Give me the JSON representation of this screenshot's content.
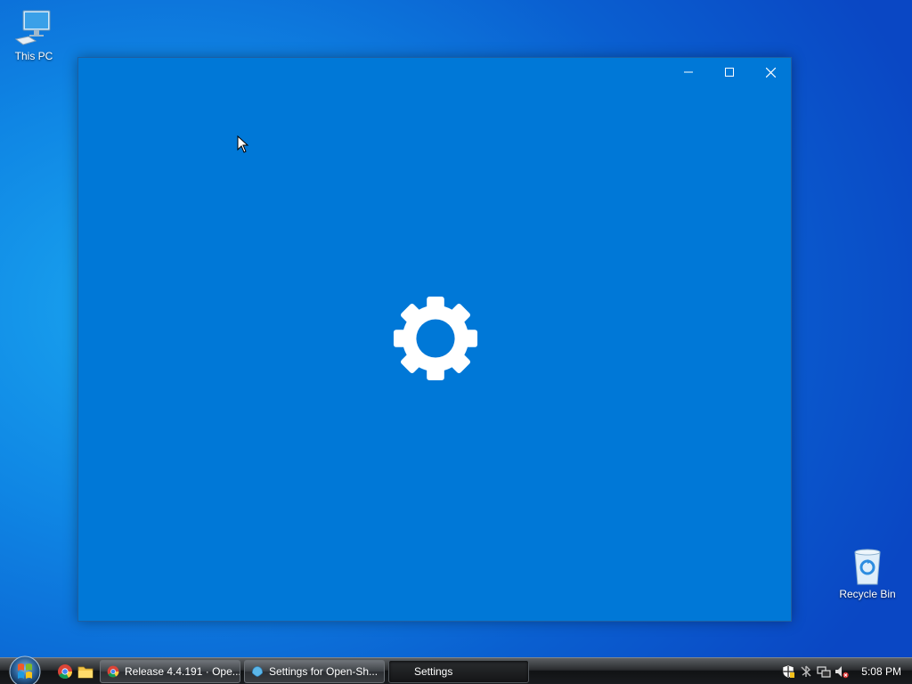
{
  "desktop": {
    "icons": [
      {
        "label": "This PC"
      },
      {
        "label": "Recycle Bin"
      }
    ]
  },
  "window": {
    "title": "Settings",
    "state": "loading"
  },
  "taskbar": {
    "tasks": [
      {
        "label": "Release 4.4.191 · Ope...",
        "icon": "chrome-icon"
      },
      {
        "label": "Settings for Open-Sh...",
        "icon": "open-shell-icon"
      },
      {
        "label": "Settings",
        "icon": "none",
        "active": true
      }
    ],
    "quick_launch": [
      "chrome-icon",
      "file-explorer-icon"
    ],
    "tray": {
      "icons": [
        "security-shield-icon",
        "bluetooth-icon",
        "network-icon",
        "volume-muted-icon"
      ],
      "clock": "5:08 PM"
    }
  },
  "colors": {
    "window_background": "#0078d7",
    "desktop_accent": "#0f86e4"
  }
}
